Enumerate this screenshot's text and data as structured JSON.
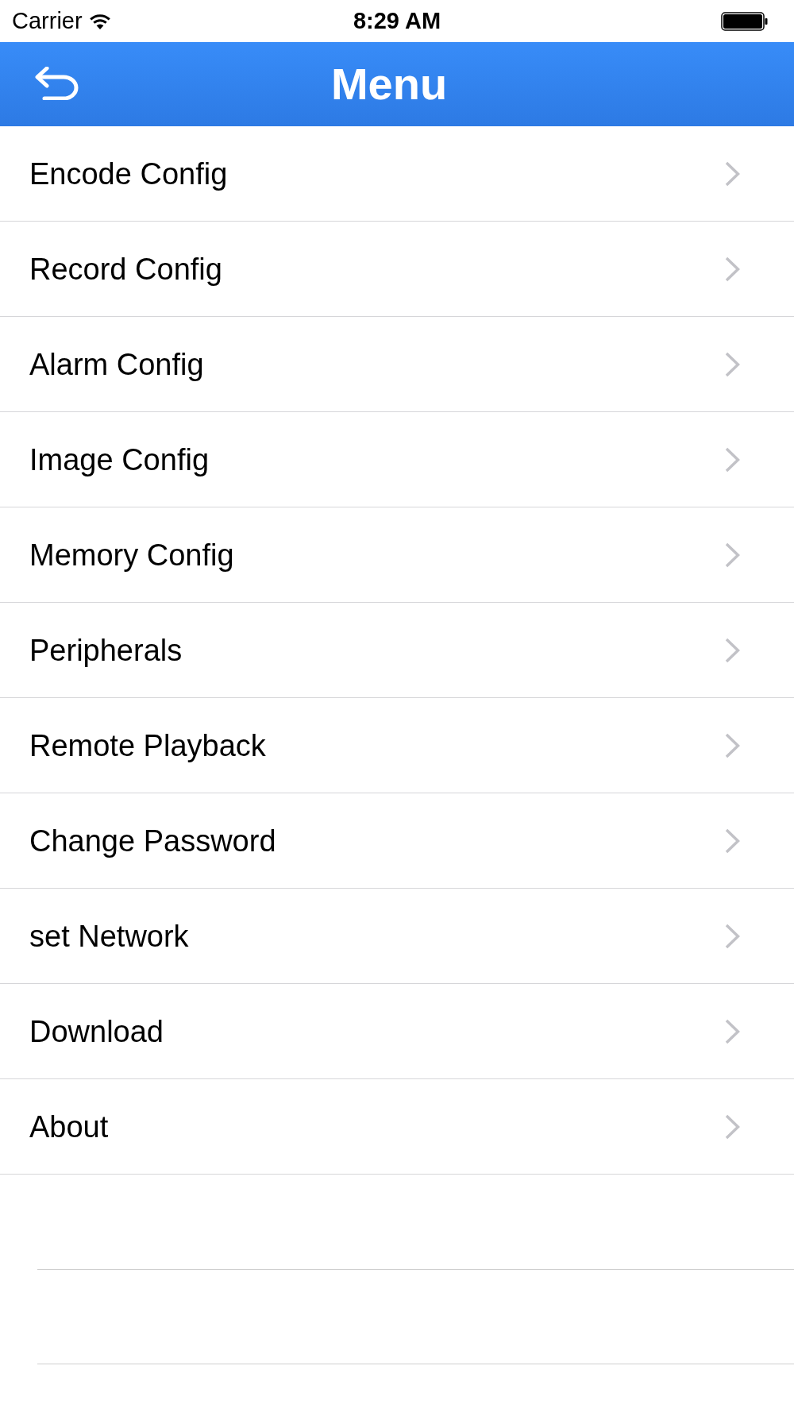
{
  "status_bar": {
    "carrier": "Carrier",
    "time": "8:29 AM"
  },
  "nav_bar": {
    "title": "Menu"
  },
  "menu_items": [
    {
      "label": "Encode Config"
    },
    {
      "label": "Record Config"
    },
    {
      "label": "Alarm Config"
    },
    {
      "label": "Image Config"
    },
    {
      "label": "Memory Config"
    },
    {
      "label": "Peripherals"
    },
    {
      "label": "Remote Playback"
    },
    {
      "label": "Change Password"
    },
    {
      "label": "set Network"
    },
    {
      "label": "Download"
    },
    {
      "label": "About"
    }
  ]
}
